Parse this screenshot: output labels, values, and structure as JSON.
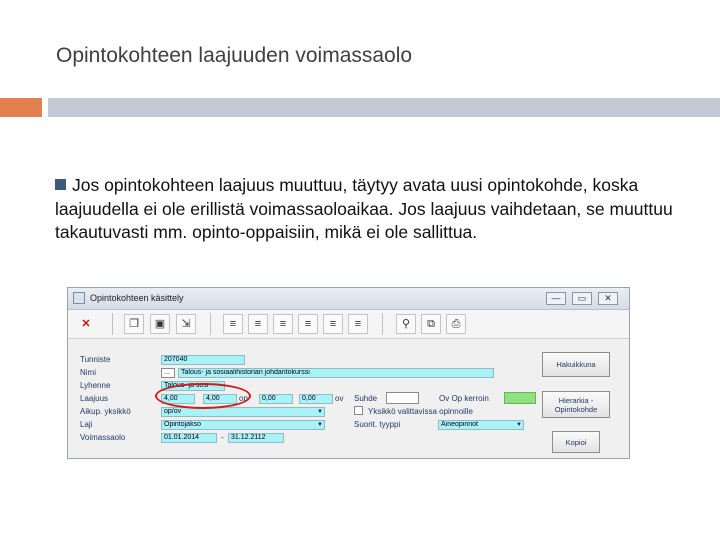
{
  "slide": {
    "title": "Opintokohteen laajuuden voimassaolo",
    "bullet": "Jos opintokohteen laajuus muuttuu, täytyy avata uusi opintokohde, koska laajuudella ei ole erillistä voimassaoloaikaa. Jos laajuus vaihdetaan, se muuttuu takautuvasti mm. opinto-oppaisiin, mikä ei ole sallittua."
  },
  "window": {
    "title": "Opintokohteen käsittely",
    "controls": {
      "minimize": "—",
      "maximize": "▭",
      "close": "✕"
    }
  },
  "toolbar": {
    "icons": [
      "close-x-icon",
      "copy-icon",
      "save-icon",
      "export-icon",
      "sort-icon",
      "sort-icon",
      "sort-icon",
      "sort-icon",
      "sort-icon",
      "sort-icon",
      "search-icon",
      "windows-icon",
      "print-icon"
    ]
  },
  "form": {
    "labels": {
      "tunniste": "Tunniste",
      "nimi": "Nimi",
      "lyhenne": "Lyhenne",
      "laajuus": "Laajuus",
      "aikup": "Aikup. yksikkö",
      "laji": "Laji",
      "voimassaolo": "Voimassaolo",
      "suhde": "Suhde",
      "ov_op_kerroin": "Ov Op kerroin",
      "yksikko_valittu": "Yksikkö valittavissa opinnoille",
      "suorit_tyyppi": "Suorit. tyyppi"
    },
    "values": {
      "tunniste": "207040",
      "nimi_prefix": "...",
      "nimi": "Talous- ja sosiaalihistorian johdantokurssi",
      "lyhenne": "Talous- ja sosi",
      "laajuus_min": "4,00",
      "laajuus_max": "4,00",
      "laajuus_unit": "op",
      "laajuus2_min": "0,00",
      "laajuus2_max": "0,00",
      "laajuus2_unit": "ov",
      "aikup": "op/ov",
      "laji": "Opintojakso",
      "voim_from": "01.01.2014",
      "voim_sep": "-",
      "voim_to": "31.12.2112",
      "suorit_tyyppi": "Aineopinnot"
    }
  },
  "buttons": {
    "hakuikkuna": "Hakuikkuna",
    "hierarkia": "Hierarkia - Opintokohde",
    "kopioi": "Kopioi"
  },
  "colors": {
    "accent_orange": "#e2804f",
    "field_cyan": "#a9f2f6",
    "highlight_red": "#d21a1a"
  }
}
